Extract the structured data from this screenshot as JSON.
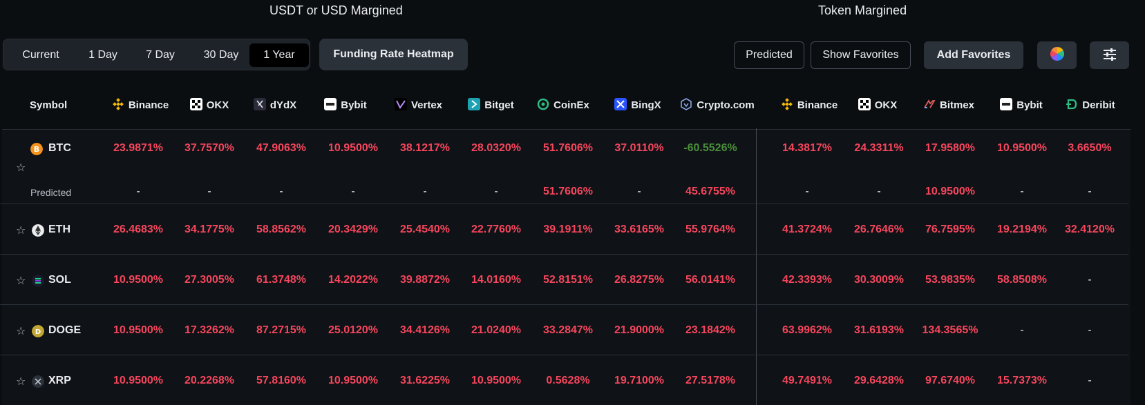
{
  "sections": {
    "left_title": "USDT or USD Margined",
    "right_title": "Token Margined"
  },
  "toolbar": {
    "periods": [
      "Current",
      "1 Day",
      "7 Day",
      "30 Day",
      "1 Year"
    ],
    "active_period": "1 Year",
    "heatmap_label": "Funding Rate Heatmap",
    "predicted_label": "Predicted",
    "show_favorites_label": "Show Favorites",
    "add_favorites_label": "Add Favorites",
    "color_icon": "color-wheel-icon",
    "settings_icon": "sliders-icon"
  },
  "table": {
    "symbol_header": "Symbol",
    "exchanges": [
      "Binance",
      "OKX",
      "dYdX",
      "Bybit",
      "Vertex",
      "Bitget",
      "CoinEx",
      "BingX",
      "Crypto.com",
      "Binance",
      "OKX",
      "Bitmex",
      "Bybit",
      "Deribit"
    ],
    "predicted_label": "Predicted",
    "rows": [
      {
        "symbol": "BTC",
        "values": [
          "23.9871%",
          "37.7570%",
          "47.9063%",
          "10.9500%",
          "38.1217%",
          "28.0320%",
          "51.7606%",
          "37.0110%",
          "-60.5526%",
          "14.3817%",
          "24.3311%",
          "17.9580%",
          "10.9500%",
          "3.6650%"
        ],
        "predicted": [
          "-",
          "-",
          "-",
          "-",
          "-",
          "-",
          "51.7606%",
          "-",
          "45.6755%",
          "-",
          "-",
          "10.9500%",
          "-",
          "-"
        ]
      },
      {
        "symbol": "ETH",
        "values": [
          "26.4683%",
          "34.1775%",
          "58.8562%",
          "20.3429%",
          "25.4540%",
          "22.7760%",
          "39.1911%",
          "33.6165%",
          "55.9764%",
          "41.3724%",
          "26.7646%",
          "76.7595%",
          "19.2194%",
          "32.4120%"
        ]
      },
      {
        "symbol": "SOL",
        "values": [
          "10.9500%",
          "27.3005%",
          "61.3748%",
          "14.2022%",
          "39.8872%",
          "14.0160%",
          "52.8151%",
          "26.8275%",
          "56.0141%",
          "42.3393%",
          "30.3009%",
          "53.9835%",
          "58.8508%",
          "-"
        ]
      },
      {
        "symbol": "DOGE",
        "values": [
          "10.9500%",
          "17.3262%",
          "87.2715%",
          "25.0120%",
          "34.4126%",
          "21.0240%",
          "33.2847%",
          "21.9000%",
          "23.1842%",
          "63.9962%",
          "31.6193%",
          "134.3565%",
          "-",
          "-"
        ]
      },
      {
        "symbol": "XRP",
        "values": [
          "10.9500%",
          "20.2268%",
          "57.8160%",
          "10.9500%",
          "31.6225%",
          "10.9500%",
          "0.5628%",
          "19.7100%",
          "27.5178%",
          "49.7491%",
          "29.6428%",
          "97.6740%",
          "15.7373%",
          "-"
        ]
      }
    ]
  },
  "colors": {
    "positive": "#f6465d",
    "negative": "#4a8f3a",
    "background": "#0b0e11"
  }
}
